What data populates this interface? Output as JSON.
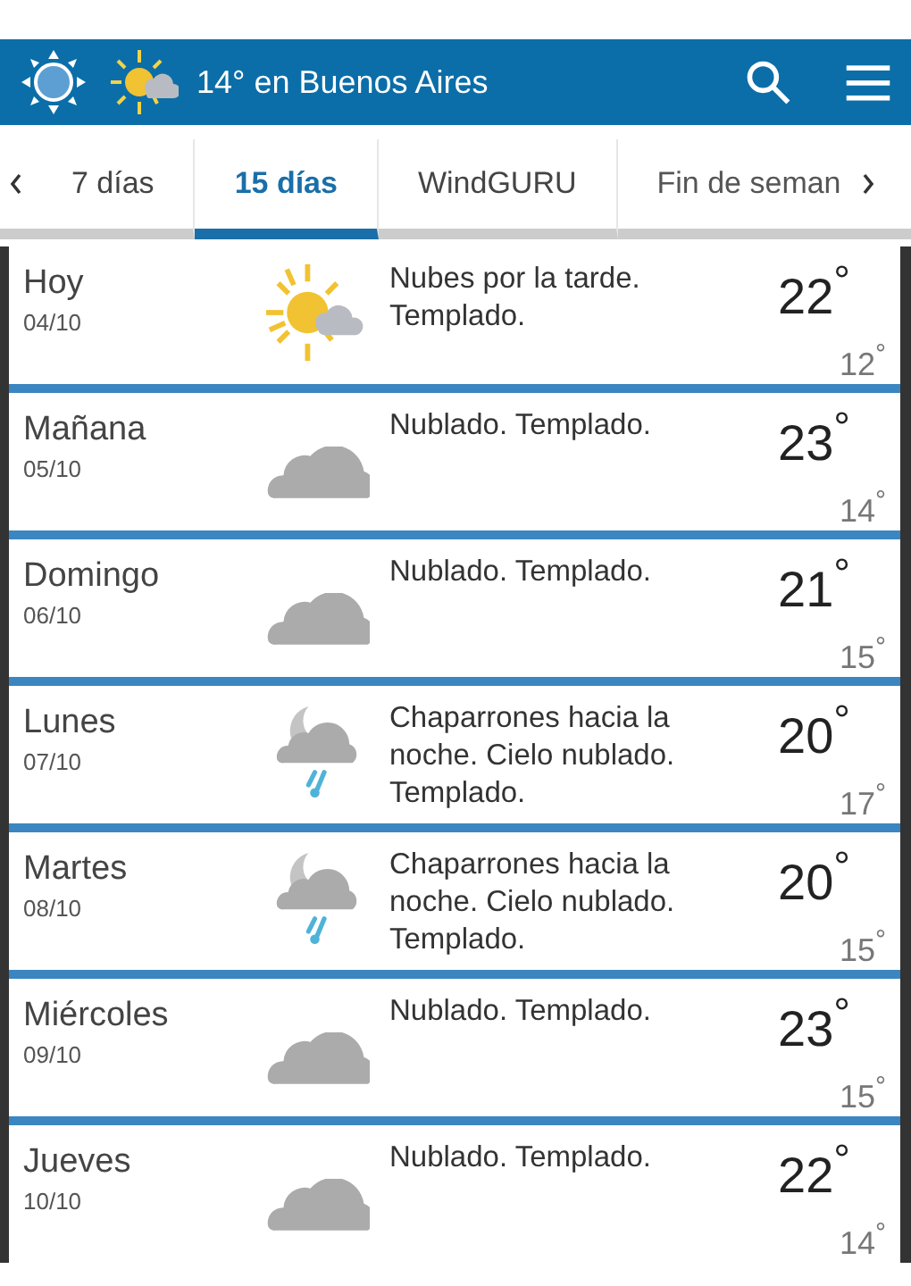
{
  "header": {
    "title": "14° en Buenos Aires"
  },
  "tabs": [
    {
      "label": "7 días",
      "selected": false
    },
    {
      "label": "15 días",
      "selected": true
    },
    {
      "label": "WindGURU",
      "selected": false
    },
    {
      "label": "Fin de seman",
      "selected": false
    }
  ],
  "days": [
    {
      "day": "Hoy",
      "date": "04/10",
      "kind": "sun-cloud",
      "text": "Nubes por la tarde. Templado.",
      "high": "22$^{°}$",
      "low": "12$^{°}$"
    },
    {
      "day": "Mañana",
      "date": "05/10",
      "kind": "cloud",
      "text": "Nublado. Templado.",
      "high": "23$^{°}$",
      "low": "14$^{°}$"
    },
    {
      "day": "Domingo",
      "date": "06/10",
      "kind": "cloud",
      "text": "Nublado. Templado.",
      "high": "21$^{°}$",
      "low": "15$^{°}$"
    },
    {
      "day": "Lunes",
      "date": "07/10",
      "kind": "moon-rain",
      "text": "Chaparrones hacia la noche. Cielo nublado. Templado.",
      "high": "20$^{°}$",
      "low": "17$^{°}$"
    },
    {
      "day": "Martes",
      "date": "08/10",
      "kind": "moon-rain",
      "text": "Chaparrones hacia la noche. Cielo nublado. Templado.",
      "high": "20$^{°}$",
      "low": "15$^{°}$"
    },
    {
      "day": "Miércoles",
      "date": "09/10",
      "kind": "cloud",
      "text": "Nublado. Templado.",
      "high": "23$^{°}$",
      "low": "15$^{°}$"
    },
    {
      "day": "Jueves",
      "date": "10/10",
      "kind": "cloud",
      "text": "Nublado. Templado.",
      "high": "22$^{°}$",
      "low": "14$^{°}$"
    }
  ]
}
